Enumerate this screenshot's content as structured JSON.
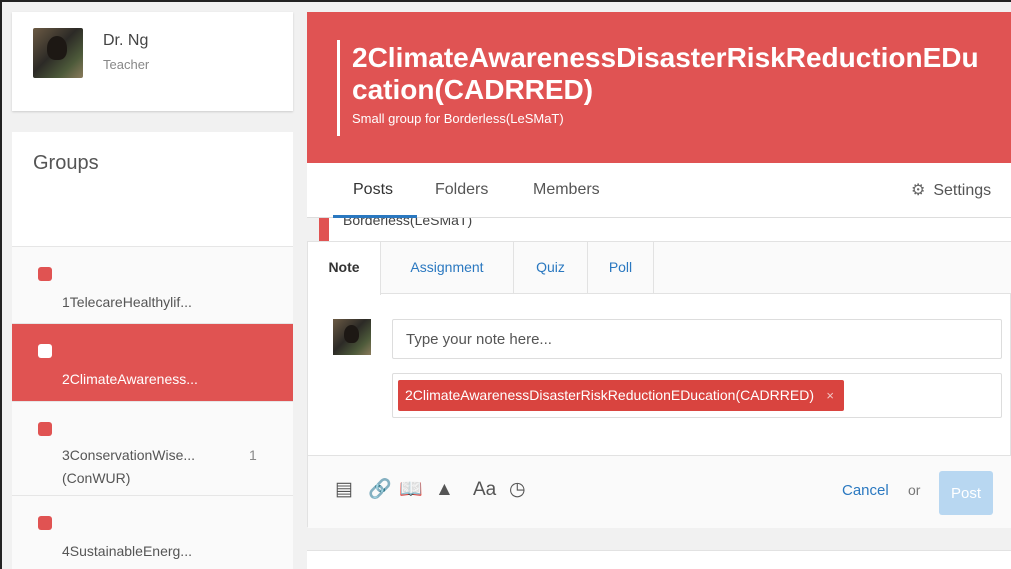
{
  "profile": {
    "name": "Dr. Ng",
    "role": "Teacher"
  },
  "groups": {
    "title": "Groups",
    "main_group": "Borderless(LeSMaT)",
    "items": [
      {
        "label_line1": "1TelecareHealthylif...",
        "label_line2": "",
        "count": ""
      },
      {
        "label_line1": "2ClimateAwareness...",
        "label_line2": "",
        "count": ""
      },
      {
        "label_line1": "3ConservationWise...",
        "label_line2": "(ConWUR)",
        "count": "1"
      },
      {
        "label_line1": "4SustainableEnerg...",
        "label_line2": "",
        "count": ""
      }
    ]
  },
  "banner": {
    "title": "2ClimateAwarenessDisasterRiskReductionEDucation(CADRRED)",
    "subtitle": "Small group for Borderless(LeSMaT)"
  },
  "tabs": {
    "posts": "Posts",
    "folders": "Folders",
    "members": "Members",
    "settings": "Settings"
  },
  "composer": {
    "tabs": {
      "note": "Note",
      "assignment": "Assignment",
      "quiz": "Quiz",
      "poll": "Poll"
    },
    "placeholder": "Type your note here...",
    "recipient_chip": "2ClimateAwarenessDisasterRiskReductionEDucation(CADRRED)",
    "chip_remove": "×",
    "tools": {
      "file": "▤",
      "link": "🔗",
      "library": "📖",
      "drive": "▲",
      "font": "Aa",
      "schedule": "◷"
    },
    "cancel": "Cancel",
    "or": "or",
    "post": "Post"
  },
  "colors": {
    "brand": "#e05353",
    "link": "#2a78c0",
    "post_disabled": "#b8d7f1"
  }
}
